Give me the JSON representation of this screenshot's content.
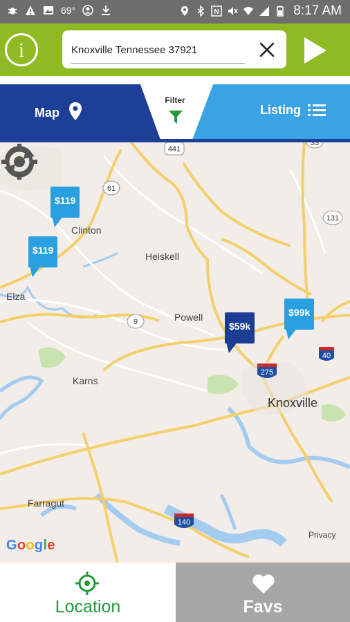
{
  "status_bar": {
    "left_icons": [
      "bug-icon",
      "warning-icon",
      "image-icon",
      "weather-icon",
      "account-icon",
      "download-icon"
    ],
    "temperature": "69°",
    "right_icons": [
      "location-icon",
      "bluetooth-icon",
      "nfc-icon",
      "mute-icon",
      "wifi-icon",
      "signal-icon",
      "battery-icon"
    ],
    "time": "8:17 AM"
  },
  "search": {
    "info_label": "i",
    "value": "Knoxville Tennessee 37921"
  },
  "tabs": {
    "map_label": "Map",
    "filter_label": "Filter",
    "listing_label": "Listing"
  },
  "map": {
    "places": {
      "clinton": "Clinton",
      "heiskell": "Heiskell",
      "elza": "Elza",
      "powell": "Powell",
      "karns": "Karns",
      "knoxville": "Knoxville",
      "farragut": "Farragut"
    },
    "shields": {
      "r441": "441",
      "r61": "61",
      "r9": "9",
      "r33": "33",
      "r131": "131",
      "i275": "275",
      "i40": "40",
      "i140": "140"
    },
    "markers": [
      {
        "price": "$119",
        "style": "light"
      },
      {
        "price": "$119",
        "style": "light"
      },
      {
        "price": "$59k",
        "style": "dark"
      },
      {
        "price": "$99k",
        "style": "light"
      }
    ],
    "google_logo": "Google",
    "privacy": "Privacy"
  },
  "bottom_nav": {
    "location_label": "Location",
    "favs_label": "Favs"
  },
  "colors": {
    "accent_green": "#8fba23",
    "tab_dark_blue": "#1d3f97",
    "tab_light_blue": "#3aa3e3",
    "location_green": "#229a3a",
    "favs_gray": "#a6a6a6"
  }
}
